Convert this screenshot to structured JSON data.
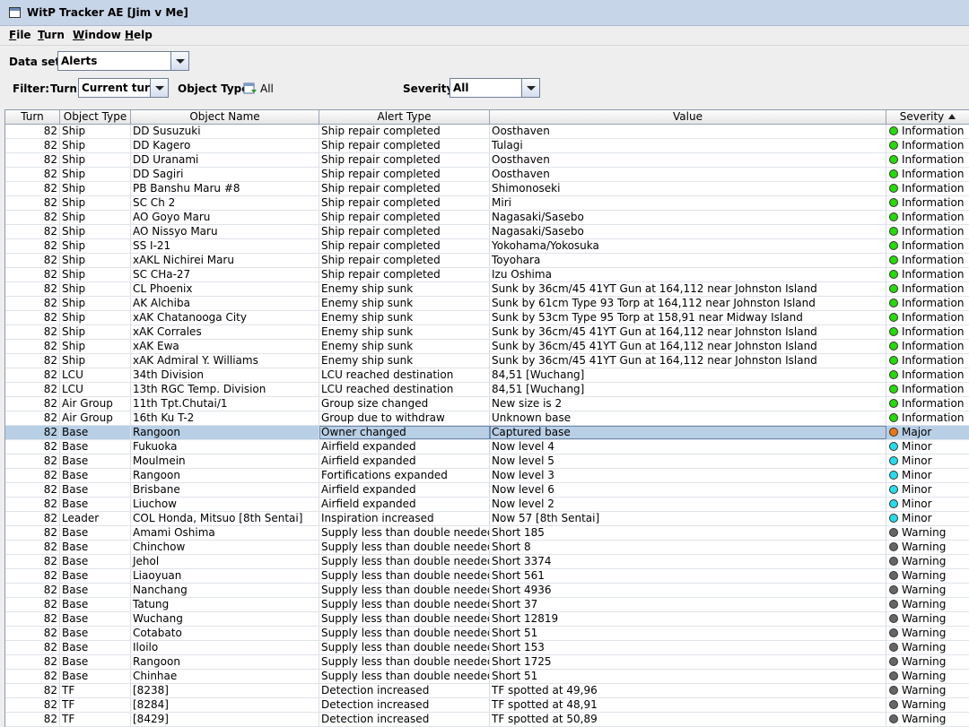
{
  "window": {
    "title": "WitP Tracker AE [Jim v Me]"
  },
  "menu": [
    {
      "label": "File",
      "u": "F",
      "rest": "ile"
    },
    {
      "label": "Turn",
      "u": "T",
      "rest": "urn"
    },
    {
      "label": "Window",
      "u": "W",
      "rest": "indow"
    },
    {
      "label": "Help",
      "u": "H",
      "rest": "elp"
    }
  ],
  "toolbar": {
    "dataset_label": "Data set:",
    "dataset_value": "Alerts",
    "filter_label": "Filter:",
    "turn_label": "Turn:",
    "turn_value": "Current turn",
    "object_type_label": "Object Type:",
    "object_type_value": "All",
    "severity_label": "Severity:",
    "severity_value": "All"
  },
  "table": {
    "columns": [
      "Turn",
      "Object Type",
      "Object Name",
      "Alert Type",
      "Value",
      "Severity"
    ],
    "sorted_column": "Severity",
    "severity_colors": {
      "Information": "#22dd00",
      "Major": "#ee7711",
      "Minor": "#22ddee",
      "Warning": "#666666"
    },
    "rows": [
      [
        "82",
        "Ship",
        "DD Susuzuki",
        "Ship repair completed",
        "Oosthaven",
        "Information"
      ],
      [
        "82",
        "Ship",
        "DD Kagero",
        "Ship repair completed",
        "Tulagi",
        "Information"
      ],
      [
        "82",
        "Ship",
        "DD Uranami",
        "Ship repair completed",
        "Oosthaven",
        "Information"
      ],
      [
        "82",
        "Ship",
        "DD Sagiri",
        "Ship repair completed",
        "Oosthaven",
        "Information"
      ],
      [
        "82",
        "Ship",
        "PB Banshu Maru #8",
        "Ship repair completed",
        "Shimonoseki",
        "Information"
      ],
      [
        "82",
        "Ship",
        "SC Ch 2",
        "Ship repair completed",
        "Miri",
        "Information"
      ],
      [
        "82",
        "Ship",
        "AO Goyo Maru",
        "Ship repair completed",
        "Nagasaki/Sasebo",
        "Information"
      ],
      [
        "82",
        "Ship",
        "AO Nissyo Maru",
        "Ship repair completed",
        "Nagasaki/Sasebo",
        "Information"
      ],
      [
        "82",
        "Ship",
        "SS I-21",
        "Ship repair completed",
        "Yokohama/Yokosuka",
        "Information"
      ],
      [
        "82",
        "Ship",
        "xAKL Nichirei Maru",
        "Ship repair completed",
        "Toyohara",
        "Information"
      ],
      [
        "82",
        "Ship",
        "SC CHa-27",
        "Ship repair completed",
        "Izu Oshima",
        "Information"
      ],
      [
        "82",
        "Ship",
        "CL Phoenix",
        "Enemy ship sunk",
        "Sunk by 36cm/45 41YT Gun at 164,112 near Johnston Island",
        "Information"
      ],
      [
        "82",
        "Ship",
        "AK Alchiba",
        "Enemy ship sunk",
        "Sunk by 61cm Type 93 Torp at 164,112 near Johnston Island",
        "Information"
      ],
      [
        "82",
        "Ship",
        "xAK Chatanooga City",
        "Enemy ship sunk",
        "Sunk by 53cm Type 95 Torp at 158,91 near Midway Island",
        "Information"
      ],
      [
        "82",
        "Ship",
        "xAK Corrales",
        "Enemy ship sunk",
        "Sunk by 36cm/45 41YT Gun at 164,112 near Johnston Island",
        "Information"
      ],
      [
        "82",
        "Ship",
        "xAK Ewa",
        "Enemy ship sunk",
        "Sunk by 36cm/45 41YT Gun at 164,112 near Johnston Island",
        "Information"
      ],
      [
        "82",
        "Ship",
        "xAK Admiral Y. Williams",
        "Enemy ship sunk",
        "Sunk by 36cm/45 41YT Gun at 164,112 near Johnston Island",
        "Information"
      ],
      [
        "82",
        "LCU",
        "34th Division",
        "LCU reached destination",
        "84,51 [Wuchang]",
        "Information"
      ],
      [
        "82",
        "LCU",
        "13th RGC Temp. Division",
        "LCU reached destination",
        "84,51 [Wuchang]",
        "Information"
      ],
      [
        "82",
        "Air Group",
        "11th Tpt.Chutai/1",
        "Group size changed",
        "New size is 2",
        "Information"
      ],
      [
        "82",
        "Air Group",
        "16th Ku T-2",
        "Group due to withdraw",
        "Unknown base",
        "Information"
      ],
      [
        "82",
        "Base",
        "Rangoon",
        "Owner changed",
        "Captured base",
        "Major"
      ],
      [
        "82",
        "Base",
        "Fukuoka",
        "Airfield expanded",
        "Now level 4",
        "Minor"
      ],
      [
        "82",
        "Base",
        "Moulmein",
        "Airfield expanded",
        "Now level 5",
        "Minor"
      ],
      [
        "82",
        "Base",
        "Rangoon",
        "Fortifications expanded",
        "Now level 3",
        "Minor"
      ],
      [
        "82",
        "Base",
        "Brisbane",
        "Airfield expanded",
        "Now level 6",
        "Minor"
      ],
      [
        "82",
        "Base",
        "Liuchow",
        "Airfield expanded",
        "Now level 2",
        "Minor"
      ],
      [
        "82",
        "Leader",
        "COL Honda, Mitsuo [8th Sentai]",
        "Inspiration increased",
        "Now 57 [8th Sentai]",
        "Minor"
      ],
      [
        "82",
        "Base",
        "Amami Oshima",
        "Supply less than double needed",
        "Short 185",
        "Warning"
      ],
      [
        "82",
        "Base",
        "Chinchow",
        "Supply less than double needed",
        "Short 8",
        "Warning"
      ],
      [
        "82",
        "Base",
        "Jehol",
        "Supply less than double needed",
        "Short 3374",
        "Warning"
      ],
      [
        "82",
        "Base",
        "Liaoyuan",
        "Supply less than double needed",
        "Short 561",
        "Warning"
      ],
      [
        "82",
        "Base",
        "Nanchang",
        "Supply less than double needed",
        "Short 4936",
        "Warning"
      ],
      [
        "82",
        "Base",
        "Tatung",
        "Supply less than double needed",
        "Short 37",
        "Warning"
      ],
      [
        "82",
        "Base",
        "Wuchang",
        "Supply less than double needed",
        "Short 12819",
        "Warning"
      ],
      [
        "82",
        "Base",
        "Cotabato",
        "Supply less than double needed",
        "Short 51",
        "Warning"
      ],
      [
        "82",
        "Base",
        "Iloilo",
        "Supply less than double needed",
        "Short 153",
        "Warning"
      ],
      [
        "82",
        "Base",
        "Rangoon",
        "Supply less than double needed",
        "Short 1725",
        "Warning"
      ],
      [
        "82",
        "Base",
        "Chinhae",
        "Supply less than double needed",
        "Short 51",
        "Warning"
      ],
      [
        "82",
        "TF",
        "[8238]",
        "Detection increased",
        "TF spotted at 49,96",
        "Warning"
      ],
      [
        "82",
        "TF",
        "[8284]",
        "Detection increased",
        "TF spotted at 48,91",
        "Warning"
      ],
      [
        "82",
        "TF",
        "[8429]",
        "Detection increased",
        "TF spotted at 50,89",
        "Warning"
      ]
    ],
    "selected_row": 21
  }
}
